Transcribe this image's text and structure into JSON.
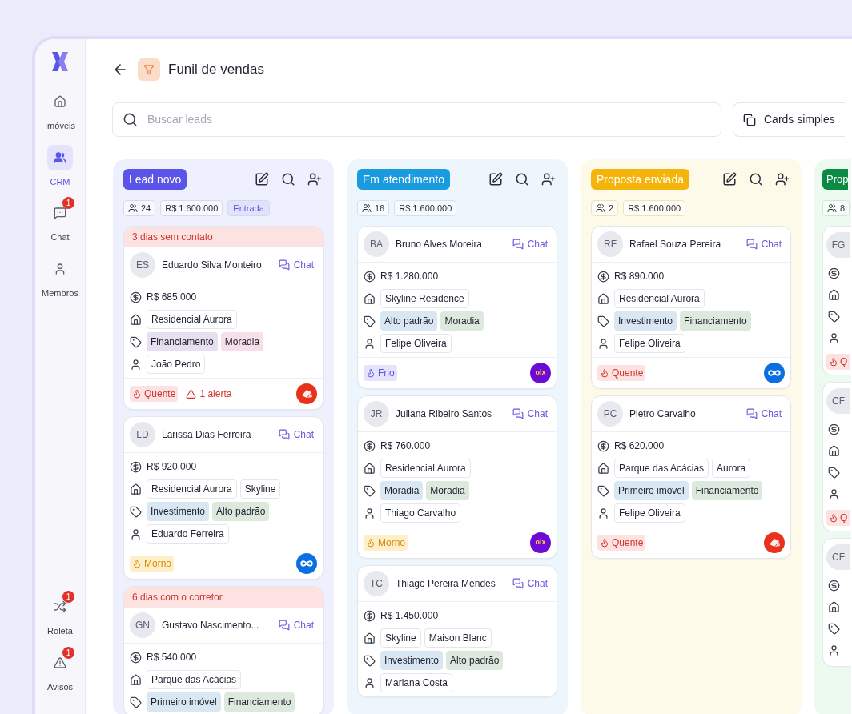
{
  "sidebar": {
    "items": [
      {
        "kind": "home",
        "label": "Imóveis",
        "selected": false
      },
      {
        "kind": "crm",
        "label": "CRM",
        "selected": true
      },
      {
        "kind": "chat",
        "label": "Chat",
        "selected": false,
        "badge": "1"
      },
      {
        "kind": "members",
        "label": "Membros",
        "selected": false
      }
    ],
    "bottom_items": [
      {
        "kind": "roulette",
        "label": "Roleta",
        "selected": false,
        "badge": "1"
      },
      {
        "kind": "alerts",
        "label": "Avisos",
        "selected": false,
        "badge": "1"
      }
    ]
  },
  "header": {
    "title": "Funil de vendas"
  },
  "search": {
    "placeholder": "Buscar leads"
  },
  "view_button": "Cards simples",
  "columns": [
    {
      "kind": "full",
      "label": "Lead novo",
      "color": "#5b54e8",
      "count": "24",
      "total": "R$ 1.600.000",
      "badge": "Entrada",
      "cards": [
        {
          "alert": "3 dias sem contato",
          "initials": "ES",
          "name": "Eduardo Silva Monteiro",
          "chat": "Chat",
          "amount": "R$ 685.000",
          "properties": [
            "Residencial Aurora"
          ],
          "tags": [
            {
              "label": "Financiamento",
              "color": "#e5dff0"
            },
            {
              "label": "Moradia",
              "color": "#f7dfea"
            }
          ],
          "agent": "João Pedro",
          "temperature": {
            "kind": "hot",
            "label": "Quente"
          },
          "alerts": "1 alerta",
          "source": {
            "kind": "red"
          }
        },
        {
          "initials": "LD",
          "name": "Larissa Dias Ferreira",
          "chat": "Chat",
          "amount": "R$ 920.000",
          "properties": [
            "Residencial Aurora",
            "Skyline"
          ],
          "tags": [
            {
              "label": "Investimento",
              "color": "#d8e7f2"
            },
            {
              "label": "Alto padrão",
              "color": "#dde9dd"
            }
          ],
          "agent": "Eduardo Ferreira",
          "temperature": {
            "kind": "warm",
            "label": "Morno"
          },
          "source": {
            "kind": "blue"
          }
        },
        {
          "alert": "6 dias com o corretor",
          "initials": "GN",
          "name": "Gustavo Nascimento...",
          "chat": "Chat",
          "amount": "R$ 540.000",
          "properties": [
            "Parque das Acácias"
          ],
          "tags": [
            {
              "label": "Primeiro imóvel",
              "color": "#d8e7f2"
            },
            {
              "label": "Financiamento",
              "color": "#dde9dd"
            }
          ]
        }
      ]
    },
    {
      "kind": "full",
      "label": "Em atendimento",
      "color": "#1a9be0",
      "count": "16",
      "total": "R$ 1.600.000",
      "cards": [
        {
          "initials": "BA",
          "name": "Bruno Alves Moreira",
          "chat": "Chat",
          "amount": "R$ 1.280.000",
          "properties": [
            "Skyline Residence"
          ],
          "tags": [
            {
              "label": "Alto padrão",
              "color": "#d8e7f2"
            },
            {
              "label": "Moradia",
              "color": "#dde9dd"
            }
          ],
          "agent": "Felipe Oliveira",
          "temperature": {
            "kind": "cold",
            "label": "Frio"
          },
          "source": {
            "kind": "purple",
            "text": "olx"
          }
        },
        {
          "initials": "JR",
          "name": "Juliana Ribeiro Santos",
          "chat": "Chat",
          "amount": "R$ 760.000",
          "properties": [
            "Residencial Aurora"
          ],
          "tags": [
            {
              "label": "Moradia",
              "color": "#d8e7f2"
            },
            {
              "label": "Moradia",
              "color": "#dde9dd"
            }
          ],
          "agent": "Thiago Carvalho",
          "temperature": {
            "kind": "warm",
            "label": "Morno"
          },
          "source": {
            "kind": "purple",
            "text": "olx"
          }
        },
        {
          "initials": "TC",
          "name": "Thiago Pereira Mendes",
          "chat": "Chat",
          "amount": "R$ 1.450.000",
          "properties": [
            "Skyline",
            "Maison Blanc"
          ],
          "tags": [
            {
              "label": "Investimento",
              "color": "#d8e7f2"
            },
            {
              "label": "Alto padrão",
              "color": "#dde9dd"
            }
          ],
          "agent": "Mariana Costa"
        }
      ]
    },
    {
      "kind": "full",
      "label": "Proposta enviada",
      "color": "#f5b40a",
      "count": "2",
      "total": "R$ 1.600.000",
      "cards": [
        {
          "initials": "RF",
          "name": "Rafael Souza Pereira",
          "chat": "Chat",
          "amount": "R$ 890.000",
          "properties": [
            "Residencial Aurora"
          ],
          "tags": [
            {
              "label": "Investimento",
              "color": "#d8e7f2"
            },
            {
              "label": "Financiamento",
              "color": "#dde9dd"
            }
          ],
          "agent": "Felipe Oliveira",
          "temperature": {
            "kind": "hot",
            "label": "Quente"
          },
          "source": {
            "kind": "blue"
          }
        },
        {
          "initials": "PC",
          "name": "Pietro Carvalho",
          "chat": "Chat",
          "amount": "R$ 620.000",
          "properties": [
            "Parque das Acácias",
            "Aurora"
          ],
          "tags": [
            {
              "label": "Primeiro imóvel",
              "color": "#d8e7f2"
            },
            {
              "label": "Financiamento",
              "color": "#dde9dd"
            }
          ],
          "agent": "Felipe Oliveira",
          "temperature": {
            "kind": "hot",
            "label": "Quente"
          },
          "source": {
            "kind": "red"
          }
        }
      ]
    },
    {
      "kind": "clipped",
      "label": "Prop",
      "color": "#0b8a44",
      "count": "8",
      "cards": [
        {
          "initials": "FG",
          "temperature": {
            "kind": "hot",
            "label": "Q"
          }
        },
        {
          "initials": "CF",
          "temperature": {
            "kind": "hot",
            "label": "Q"
          }
        },
        {
          "initials": "CF"
        }
      ]
    }
  ]
}
